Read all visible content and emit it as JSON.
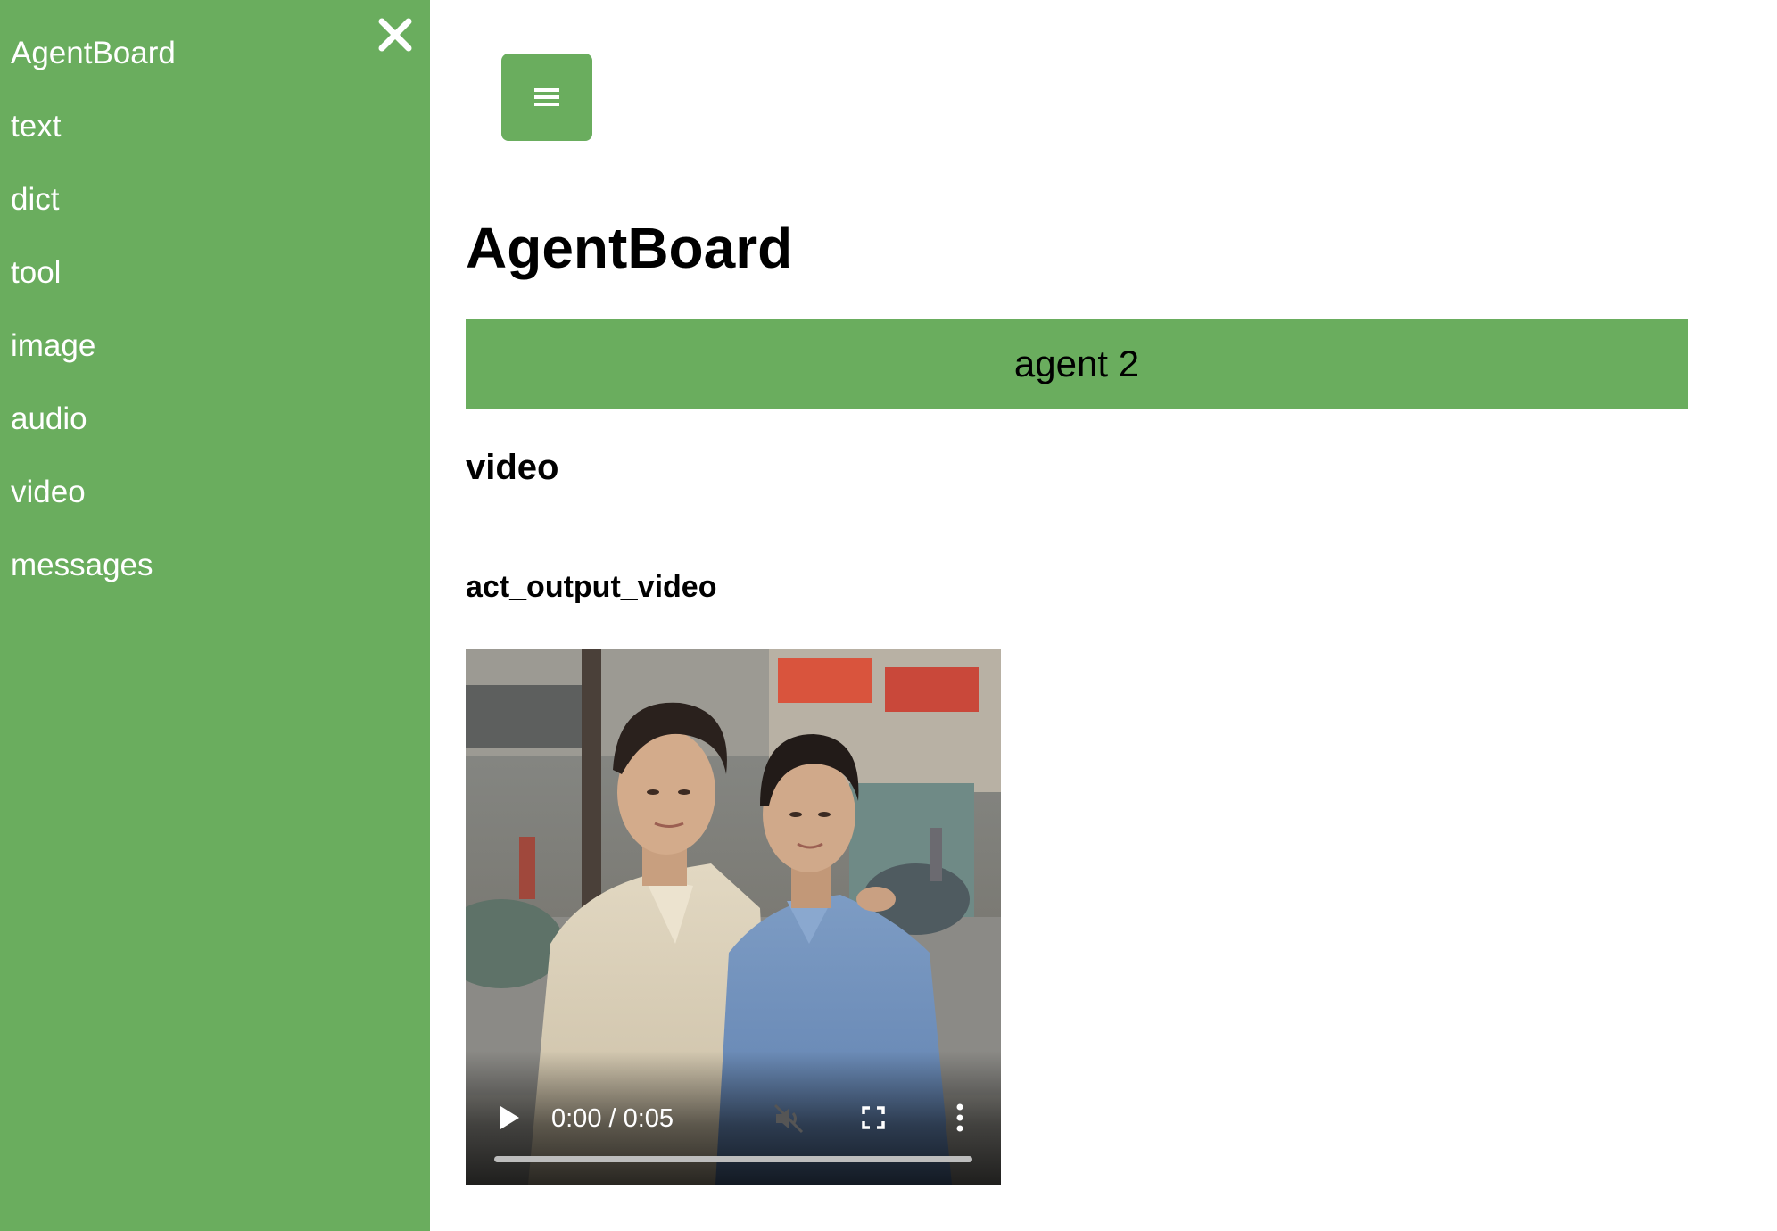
{
  "sidebar": {
    "items": [
      {
        "label": "AgentBoard"
      },
      {
        "label": "text"
      },
      {
        "label": "dict"
      },
      {
        "label": "tool"
      },
      {
        "label": "image"
      },
      {
        "label": "audio"
      },
      {
        "label": "video"
      },
      {
        "label": "messages"
      }
    ],
    "close_icon": "close-icon",
    "background_color": "#6aad5e"
  },
  "header": {
    "menu_icon": "hamburger-icon",
    "title": "AgentBoard"
  },
  "main": {
    "agent_label": "agent 2",
    "section_title": "video",
    "item_title": "act_output_video",
    "video": {
      "time_display": "0:00 / 0:05",
      "progress": 0.0,
      "muted": true,
      "icons": [
        "play-icon",
        "mute-icon",
        "fullscreen-icon",
        "more-options-icon"
      ]
    }
  }
}
